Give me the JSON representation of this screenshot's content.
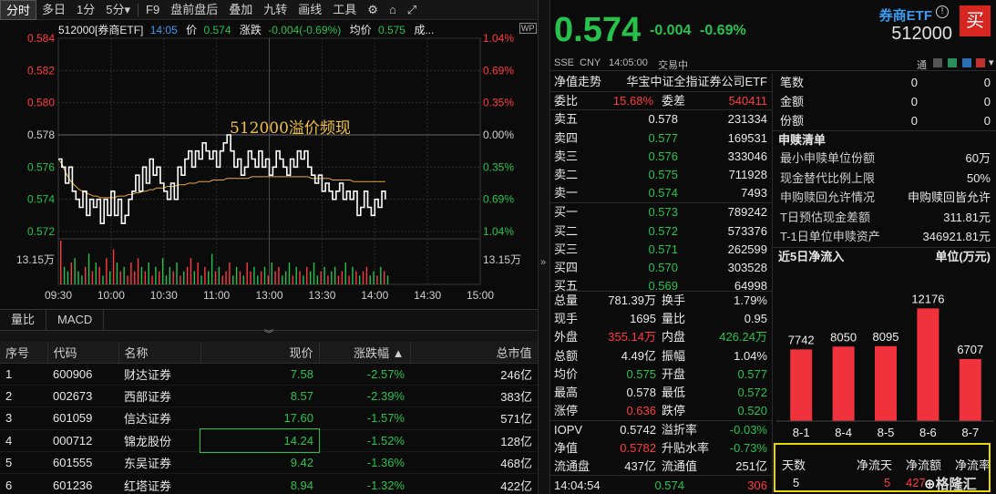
{
  "toolbar": {
    "items": [
      "分时",
      "多日",
      "1分",
      "5分",
      "F9",
      "盘前盘后",
      "叠加",
      "九转",
      "画线",
      "工具"
    ],
    "dropdown_arrow": "▾"
  },
  "chart_header": {
    "symbol": "512000[券商ETF]",
    "time": "14:05",
    "price_label": "价",
    "price": "0.574",
    "change_label": "涨跌",
    "change": "-0.004(-0.69%)",
    "avg_label": "均价",
    "avg": "0.575",
    "more": "成..."
  },
  "annotation": "512000溢价频现",
  "chart_data": {
    "type": "line",
    "y_ticks": [
      "0.584",
      "0.582",
      "0.580",
      "0.578",
      "0.576",
      "0.574",
      "0.572"
    ],
    "y_pct_ticks": [
      "1.04%",
      "0.69%",
      "0.35%",
      "0.00%",
      "0.35%",
      "0.69%",
      "1.04%"
    ],
    "volume_label": "13.15万",
    "x_ticks": [
      "09:30",
      "10:00",
      "10:30",
      "11:00",
      "13:00",
      "13:30",
      "14:00",
      "14:30",
      "15:00"
    ],
    "ylim": [
      0.572,
      0.584
    ],
    "price_series": [
      0.5765,
      0.576,
      0.575,
      0.576,
      0.5745,
      0.574,
      0.5735,
      0.5745,
      0.573,
      0.574,
      0.5735,
      0.574,
      0.5725,
      0.574,
      0.573,
      0.5745,
      0.573,
      0.574,
      0.5725,
      0.573,
      0.574,
      0.5745,
      0.5755,
      0.5745,
      0.576,
      0.575,
      0.5765,
      0.5755,
      0.576,
      0.575,
      0.5745,
      0.574,
      0.575,
      0.574,
      0.576,
      0.5755,
      0.5765,
      0.577,
      0.576,
      0.577,
      0.5765,
      0.5775,
      0.577,
      0.5765,
      0.577,
      0.576,
      0.577,
      0.5775,
      0.578,
      0.577,
      0.576,
      0.5765,
      0.5755,
      0.576,
      0.577,
      0.5765,
      0.576,
      0.577,
      0.576,
      0.5765,
      0.5755,
      0.576,
      0.577,
      0.5765,
      0.576,
      0.5755,
      0.5765,
      0.576,
      0.577,
      0.5765,
      0.577,
      0.576,
      0.5755,
      0.575,
      0.5755,
      0.5745,
      0.575,
      0.5745,
      0.574,
      0.5745,
      0.575,
      0.574,
      0.5745,
      0.574,
      0.5745,
      0.573,
      0.5735,
      0.5745,
      0.5735,
      0.573,
      0.574,
      0.5735,
      0.5745,
      0.574
    ],
    "avg_series": [
      0.5765,
      0.5762,
      0.5757,
      0.5753,
      0.575,
      0.5748,
      0.5746,
      0.5745,
      0.5744,
      0.5743,
      0.5742,
      0.5742,
      0.5741,
      0.5741,
      0.5741,
      0.5741,
      0.5741,
      0.5742,
      0.5742,
      0.5742,
      0.5743,
      0.5743,
      0.5744,
      0.5744,
      0.5745,
      0.5745,
      0.5746,
      0.5746,
      0.5747,
      0.5747,
      0.5747,
      0.5748,
      0.5748,
      0.5748,
      0.5749,
      0.5749,
      0.5749,
      0.575,
      0.575,
      0.575,
      0.5751,
      0.5751,
      0.5751,
      0.5751,
      0.5752,
      0.5752,
      0.5752,
      0.5752,
      0.5753,
      0.5753,
      0.5753,
      0.5753,
      0.5753,
      0.5753,
      0.5753,
      0.5754,
      0.5754,
      0.5754,
      0.5754,
      0.5754,
      0.5754,
      0.5754,
      0.5754,
      0.5754,
      0.5754,
      0.5754,
      0.5754,
      0.5754,
      0.5754,
      0.5754,
      0.5754,
      0.5754,
      0.5753,
      0.5753,
      0.5753,
      0.5753,
      0.5753,
      0.5753,
      0.5752,
      0.5752,
      0.5752,
      0.5752,
      0.5752,
      0.5752,
      0.5751,
      0.5751,
      0.5751,
      0.5751,
      0.5751,
      0.5751,
      0.5751,
      0.5751,
      0.5751,
      0.5751
    ],
    "volume_series": [
      10,
      4,
      3,
      5,
      6,
      3,
      2,
      4,
      7,
      3,
      5,
      4,
      2,
      6,
      3,
      8,
      5,
      3,
      4,
      2,
      5,
      3,
      6,
      4,
      3,
      5,
      2,
      4,
      3,
      6,
      2,
      4,
      3,
      5,
      2,
      3,
      4,
      6,
      3,
      5,
      2,
      4,
      3,
      7,
      3,
      4,
      2,
      3,
      5,
      2,
      4,
      3,
      2,
      5,
      3,
      4,
      2,
      3,
      4,
      2,
      5,
      3,
      4,
      2,
      3,
      5,
      2,
      4,
      3,
      2,
      4,
      3,
      5,
      2,
      3,
      4,
      2,
      3,
      4,
      2,
      3,
      5,
      2,
      4,
      3,
      2,
      3,
      4,
      2,
      3,
      2,
      4,
      3,
      2
    ]
  },
  "indicator_tabs": [
    "量比",
    "MACD"
  ],
  "table": {
    "headers": [
      "序号",
      "代码",
      "名称",
      "现价",
      "涨跌幅 ▲",
      "总市值"
    ],
    "rows": [
      {
        "n": "1",
        "code": "600906",
        "name": "财达证券",
        "price": "7.58",
        "pct": "-2.57%",
        "cap": "246亿"
      },
      {
        "n": "2",
        "code": "002673",
        "name": "西部证券",
        "price": "8.57",
        "pct": "-2.39%",
        "cap": "383亿"
      },
      {
        "n": "3",
        "code": "601059",
        "name": "信达证券",
        "price": "17.60",
        "pct": "-1.57%",
        "cap": "571亿"
      },
      {
        "n": "4",
        "code": "000712",
        "name": "锦龙股份",
        "price": "14.24",
        "pct": "-1.52%",
        "cap": "128亿"
      },
      {
        "n": "5",
        "code": "601555",
        "name": "东吴证券",
        "price": "9.42",
        "pct": "-1.36%",
        "cap": "468亿"
      },
      {
        "n": "6",
        "code": "601236",
        "name": "红塔证券",
        "price": "8.94",
        "pct": "-1.32%",
        "cap": "422亿"
      }
    ]
  },
  "quote": {
    "price": "0.574",
    "change": "-0.004",
    "change_pct": "-0.69%",
    "name": "券商ETF",
    "code": "512000",
    "buy": "买",
    "exchange": "SSE",
    "currency": "CNY",
    "time": "14:05:00",
    "status": "交易中",
    "tool_label": "通"
  },
  "book": {
    "nav_label": "净值走势",
    "fund_name": "华宝中证全指证券公司ETF",
    "ratio_label": "委比",
    "ratio": "15.68%",
    "diff_label": "委差",
    "diff": "540411",
    "asks": [
      {
        "label": "卖五",
        "price": "0.578",
        "vol": "231334"
      },
      {
        "label": "卖四",
        "price": "0.577",
        "vol": "169531"
      },
      {
        "label": "卖三",
        "price": "0.576",
        "vol": "333046"
      },
      {
        "label": "卖二",
        "price": "0.575",
        "vol": "711928"
      },
      {
        "label": "卖一",
        "price": "0.574",
        "vol": "7493"
      }
    ],
    "bids": [
      {
        "label": "买一",
        "price": "0.573",
        "vol": "789242"
      },
      {
        "label": "买二",
        "price": "0.572",
        "vol": "573376"
      },
      {
        "label": "买三",
        "price": "0.571",
        "vol": "262599"
      },
      {
        "label": "买四",
        "price": "0.570",
        "vol": "303528"
      },
      {
        "label": "买五",
        "price": "0.569",
        "vol": "64998"
      }
    ]
  },
  "stats": [
    {
      "k1": "总量",
      "v1": "781.39万",
      "c1": "white",
      "k2": "换手",
      "v2": "1.79%",
      "c2": "white"
    },
    {
      "k1": "现手",
      "v1": "1695",
      "c1": "white",
      "k2": "量比",
      "v2": "0.95",
      "c2": "white"
    },
    {
      "k1": "外盘",
      "v1": "355.14万",
      "c1": "red",
      "k2": "内盘",
      "v2": "426.24万",
      "c2": "green"
    },
    {
      "k1": "总额",
      "v1": "4.49亿",
      "c1": "white",
      "k2": "振幅",
      "v2": "1.04%",
      "c2": "white"
    },
    {
      "k1": "均价",
      "v1": "0.575",
      "c1": "green",
      "k2": "开盘",
      "v2": "0.577",
      "c2": "green"
    },
    {
      "k1": "最高",
      "v1": "0.578",
      "c1": "white",
      "k2": "最低",
      "v2": "0.572",
      "c2": "green"
    },
    {
      "k1": "涨停",
      "v1": "0.636",
      "c1": "red",
      "k2": "跌停",
      "v2": "0.520",
      "c2": "green"
    },
    {
      "k1": "IOPV",
      "v1": "0.5742",
      "c1": "white",
      "k2": "溢折率",
      "v2": "-0.03%",
      "c2": "green"
    },
    {
      "k1": "净值",
      "v1": "0.5782",
      "c1": "red",
      "k2": "升贴水率",
      "v2": "-0.73%",
      "c2": "green"
    },
    {
      "k1": "流通盘",
      "v1": "437亿",
      "c1": "white",
      "k2": "流通值",
      "v2": "251亿",
      "c2": "white"
    }
  ],
  "last_trade": {
    "time": "14:04:54",
    "price": "0.574",
    "vol": "306"
  },
  "rpanel": {
    "top_rows": [
      {
        "k": "笔数",
        "v1": "0",
        "v2": "0"
      },
      {
        "k": "金额",
        "v1": "0",
        "v2": "0"
      },
      {
        "k": "份额",
        "v1": "0",
        "v2": "0"
      }
    ],
    "sg_title": "申赎清单",
    "sg_rows": [
      {
        "k": "最小申赎单位份额",
        "v": "60万"
      },
      {
        "k": "现金替代比例上限",
        "v": "50%"
      },
      {
        "k": "申购赎回允许情况",
        "v": "申购赎回皆允许"
      },
      {
        "k": "T日预估现金差额",
        "v": "311.81元"
      },
      {
        "k": "T-1日单位申赎资产",
        "v": "346921.81元"
      }
    ],
    "flow_title": "近5日净流入",
    "flow_unit": "单位(万元)",
    "flow_table": {
      "headers": [
        "天数",
        "净流天",
        "净流额",
        "净流率"
      ],
      "row": [
        "5",
        "5",
        "427",
        ""
      ]
    },
    "watermark": "格隆汇"
  },
  "flow_chart": {
    "type": "bar",
    "categories": [
      "8-1",
      "8-4",
      "8-5",
      "8-6",
      "8-7"
    ],
    "values": [
      7742,
      8050,
      8095,
      12176,
      6707
    ],
    "ylim": [
      0,
      13000
    ],
    "bar_color": "#f0323c"
  }
}
